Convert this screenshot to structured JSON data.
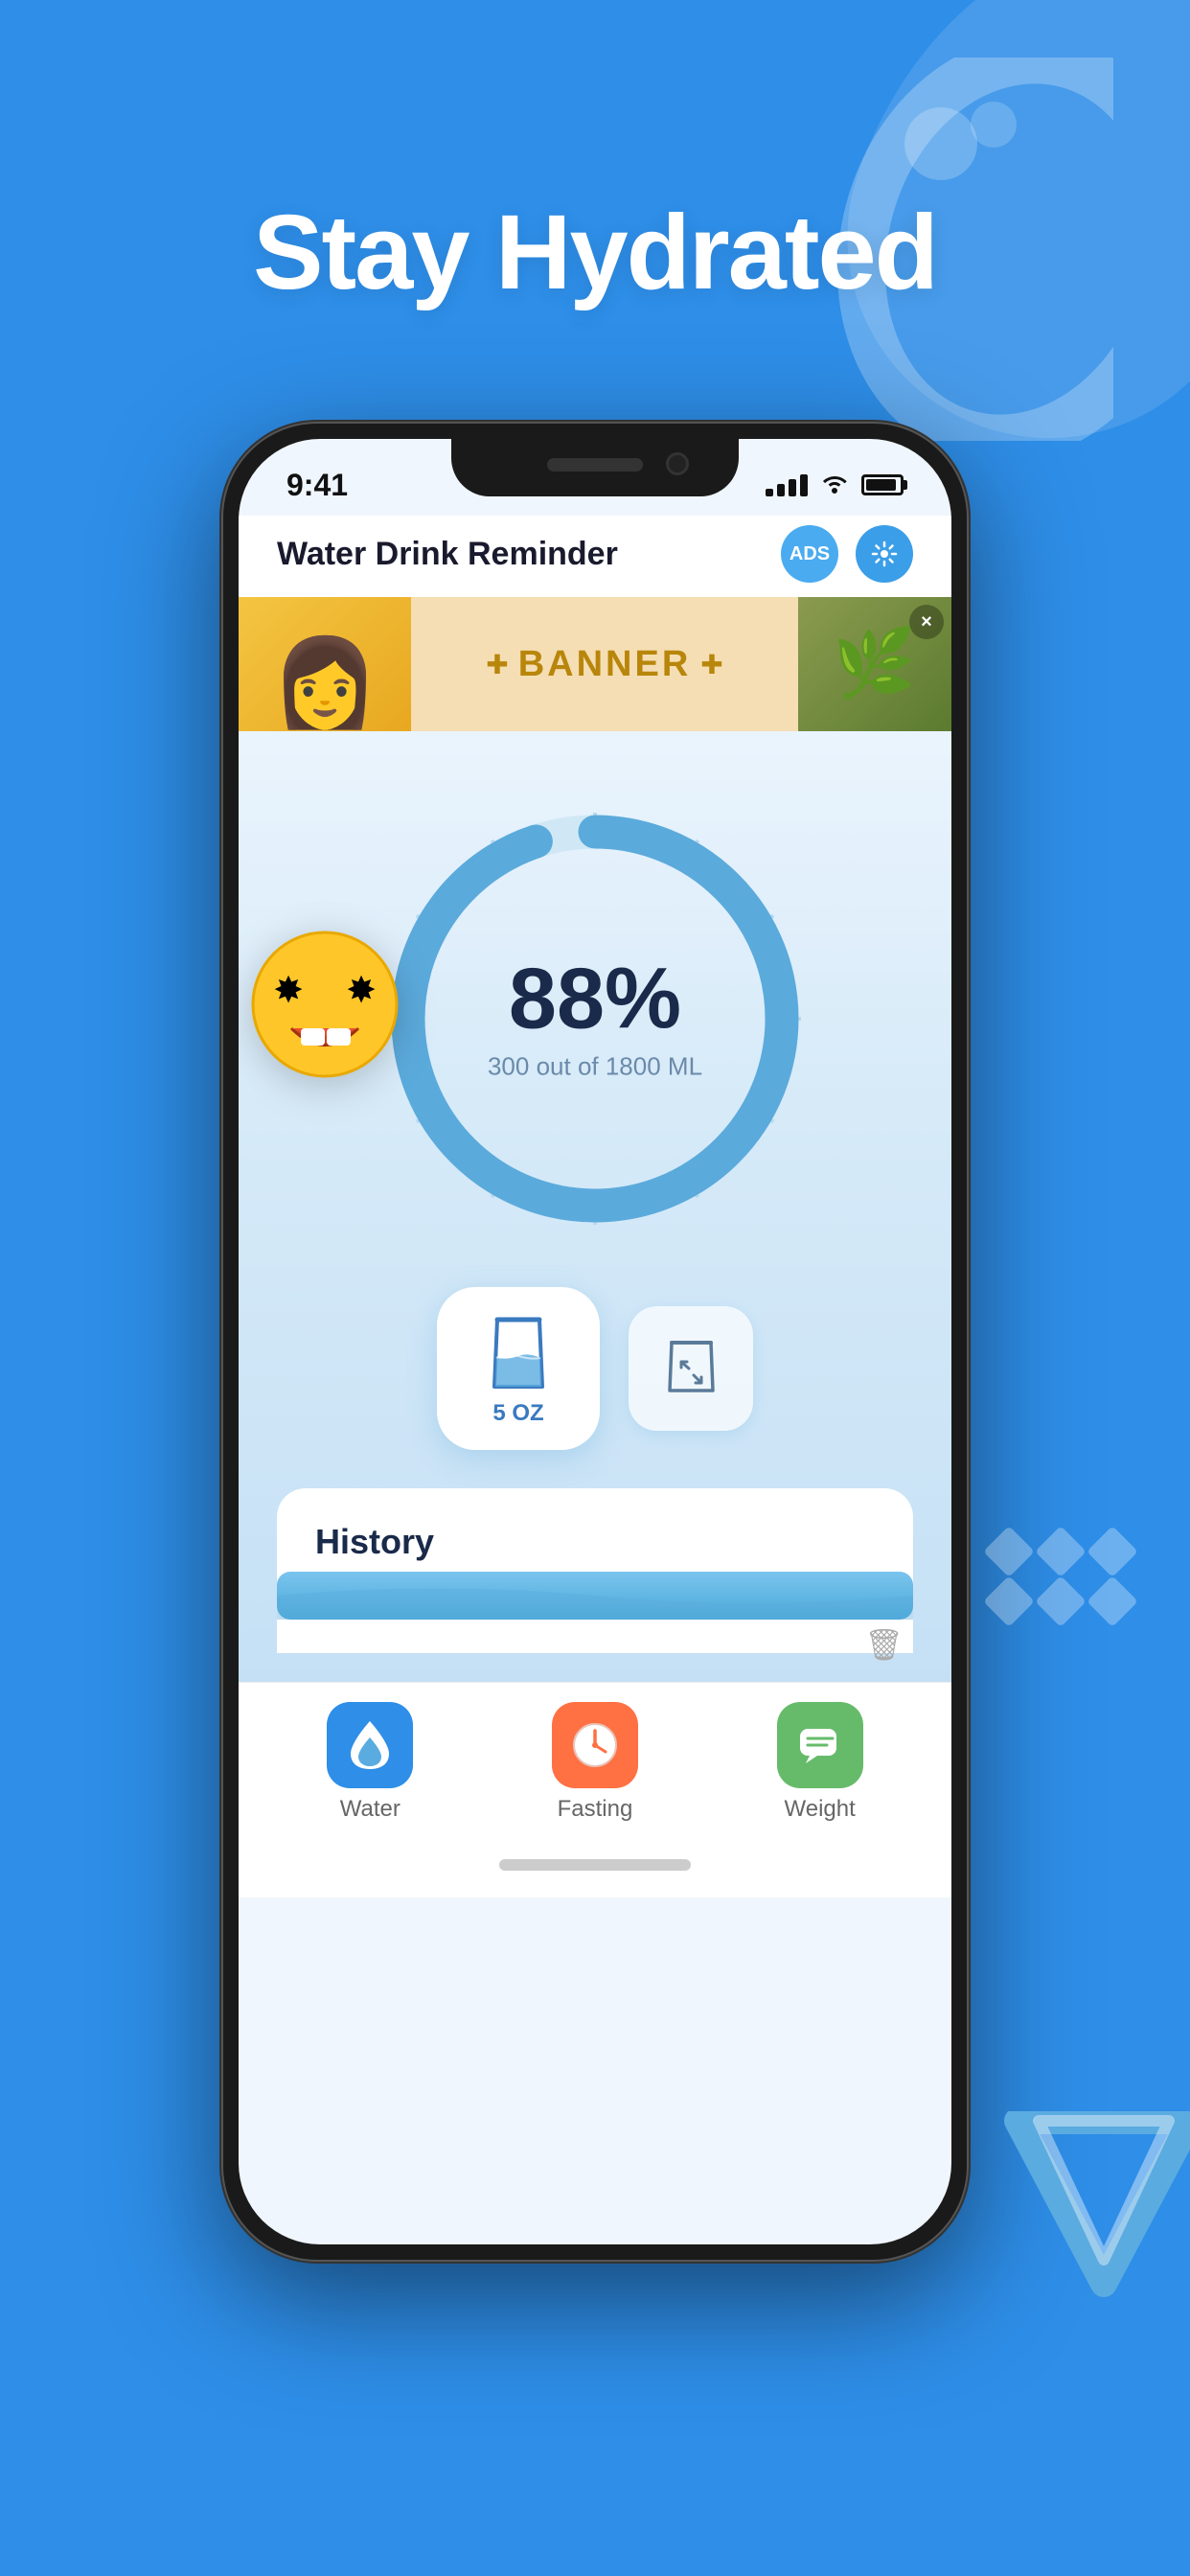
{
  "background": {
    "color": "#2E8EE8"
  },
  "hero": {
    "title": "Stay Hydrated"
  },
  "status_bar": {
    "time": "9:41",
    "signal": "4 bars",
    "wifi": "on",
    "battery": "full"
  },
  "app_header": {
    "title": "Water Drink Reminder",
    "ads_button": "ADS",
    "settings_icon": "settings"
  },
  "banner": {
    "text": "BANNER",
    "close_icon": "×"
  },
  "progress": {
    "percentage": "88%",
    "consumed": "300",
    "total": "1800",
    "unit": "ML",
    "subtitle": "300 out of 1800 ML"
  },
  "quick_add": {
    "primary_label": "5\nOZ",
    "secondary_icon": "custom"
  },
  "history": {
    "title": "History"
  },
  "bottom_nav": {
    "items": [
      {
        "id": "water",
        "label": "Water",
        "icon": "💧",
        "color": "#2E8EE8"
      },
      {
        "id": "fasting",
        "label": "Fasting",
        "icon": "⏰",
        "color": "#FF7043"
      },
      {
        "id": "weight",
        "label": "Weight",
        "icon": "💬",
        "color": "#66BB6A"
      }
    ]
  }
}
